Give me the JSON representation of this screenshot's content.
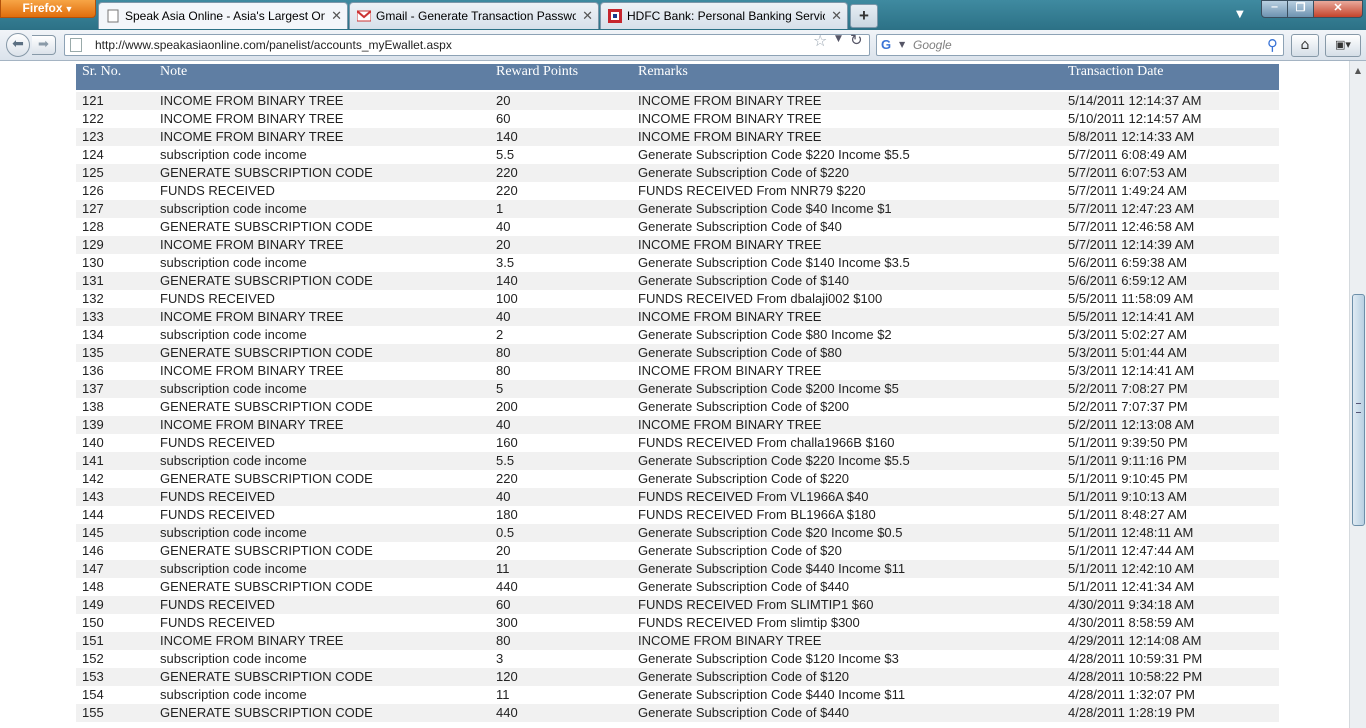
{
  "browser": {
    "menu_button": "Firefox",
    "tabs": [
      {
        "title": "Speak Asia Online - Asia's Largest Onl...",
        "active": true
      },
      {
        "title": "Gmail - Generate Transaction Passwo...",
        "active": false
      },
      {
        "title": "HDFC Bank: Personal Banking Services",
        "active": false
      }
    ],
    "new_tab": "+",
    "url": "http://www.speakasiaonline.com/panelist/accounts_myEwallet.aspx",
    "search_placeholder": "Google"
  },
  "table": {
    "headers": [
      "Sr. No.",
      "Note",
      "Reward Points",
      "Remarks",
      "Transaction Date"
    ],
    "rows": [
      [
        "121",
        "INCOME FROM BINARY TREE",
        "20",
        "INCOME FROM BINARY TREE",
        "5/14/2011 12:14:37 AM"
      ],
      [
        "122",
        "INCOME FROM BINARY TREE",
        "60",
        "INCOME FROM BINARY TREE",
        "5/10/2011 12:14:57 AM"
      ],
      [
        "123",
        "INCOME FROM BINARY TREE",
        "140",
        "INCOME FROM BINARY TREE",
        "5/8/2011 12:14:33 AM"
      ],
      [
        "124",
        "subscription code income",
        "5.5",
        "Generate Subscription Code $220 Income $5.5",
        "5/7/2011 6:08:49 AM"
      ],
      [
        "125",
        "GENERATE SUBSCRIPTION CODE",
        "220",
        "Generate Subscription Code of $220",
        "5/7/2011 6:07:53 AM"
      ],
      [
        "126",
        "FUNDS RECEIVED",
        "220",
        "FUNDS RECEIVED From NNR79 $220",
        "5/7/2011 1:49:24 AM"
      ],
      [
        "127",
        "subscription code income",
        "1",
        "Generate Subscription Code $40 Income $1",
        "5/7/2011 12:47:23 AM"
      ],
      [
        "128",
        "GENERATE SUBSCRIPTION CODE",
        "40",
        "Generate Subscription Code of $40",
        "5/7/2011 12:46:58 AM"
      ],
      [
        "129",
        "INCOME FROM BINARY TREE",
        "20",
        "INCOME FROM BINARY TREE",
        "5/7/2011 12:14:39 AM"
      ],
      [
        "130",
        "subscription code income",
        "3.5",
        "Generate Subscription Code $140 Income $3.5",
        "5/6/2011 6:59:38 AM"
      ],
      [
        "131",
        "GENERATE SUBSCRIPTION CODE",
        "140",
        "Generate Subscription Code of $140",
        "5/6/2011 6:59:12 AM"
      ],
      [
        "132",
        "FUNDS RECEIVED",
        "100",
        "FUNDS RECEIVED From dbalaji002 $100",
        "5/5/2011 11:58:09 AM"
      ],
      [
        "133",
        "INCOME FROM BINARY TREE",
        "40",
        "INCOME FROM BINARY TREE",
        "5/5/2011 12:14:41 AM"
      ],
      [
        "134",
        "subscription code income",
        "2",
        "Generate Subscription Code $80 Income $2",
        "5/3/2011 5:02:27 AM"
      ],
      [
        "135",
        "GENERATE SUBSCRIPTION CODE",
        "80",
        "Generate Subscription Code of $80",
        "5/3/2011 5:01:44 AM"
      ],
      [
        "136",
        "INCOME FROM BINARY TREE",
        "80",
        "INCOME FROM BINARY TREE",
        "5/3/2011 12:14:41 AM"
      ],
      [
        "137",
        "subscription code income",
        "5",
        "Generate Subscription Code $200 Income $5",
        "5/2/2011 7:08:27 PM"
      ],
      [
        "138",
        "GENERATE SUBSCRIPTION CODE",
        "200",
        "Generate Subscription Code of $200",
        "5/2/2011 7:07:37 PM"
      ],
      [
        "139",
        "INCOME FROM BINARY TREE",
        "40",
        "INCOME FROM BINARY TREE",
        "5/2/2011 12:13:08 AM"
      ],
      [
        "140",
        "FUNDS RECEIVED",
        "160",
        "FUNDS RECEIVED From challa1966B $160",
        "5/1/2011 9:39:50 PM"
      ],
      [
        "141",
        "subscription code income",
        "5.5",
        "Generate Subscription Code $220 Income $5.5",
        "5/1/2011 9:11:16 PM"
      ],
      [
        "142",
        "GENERATE SUBSCRIPTION CODE",
        "220",
        "Generate Subscription Code of $220",
        "5/1/2011 9:10:45 PM"
      ],
      [
        "143",
        "FUNDS RECEIVED",
        "40",
        "FUNDS RECEIVED From VL1966A $40",
        "5/1/2011 9:10:13 AM"
      ],
      [
        "144",
        "FUNDS RECEIVED",
        "180",
        "FUNDS RECEIVED From BL1966A $180",
        "5/1/2011 8:48:27 AM"
      ],
      [
        "145",
        "subscription code income",
        "0.5",
        "Generate Subscription Code $20 Income $0.5",
        "5/1/2011 12:48:11 AM"
      ],
      [
        "146",
        "GENERATE SUBSCRIPTION CODE",
        "20",
        "Generate Subscription Code of $20",
        "5/1/2011 12:47:44 AM"
      ],
      [
        "147",
        "subscription code income",
        "11",
        "Generate Subscription Code $440 Income $11",
        "5/1/2011 12:42:10 AM"
      ],
      [
        "148",
        "GENERATE SUBSCRIPTION CODE",
        "440",
        "Generate Subscription Code of $440",
        "5/1/2011 12:41:34 AM"
      ],
      [
        "149",
        "FUNDS RECEIVED",
        "60",
        "FUNDS RECEIVED From SLIMTIP1 $60",
        "4/30/2011 9:34:18 AM"
      ],
      [
        "150",
        "FUNDS RECEIVED",
        "300",
        "FUNDS RECEIVED From slimtip $300",
        "4/30/2011 8:58:59 AM"
      ],
      [
        "151",
        "INCOME FROM BINARY TREE",
        "80",
        "INCOME FROM BINARY TREE",
        "4/29/2011 12:14:08 AM"
      ],
      [
        "152",
        "subscription code income",
        "3",
        "Generate Subscription Code $120 Income $3",
        "4/28/2011 10:59:31 PM"
      ],
      [
        "153",
        "GENERATE SUBSCRIPTION CODE",
        "120",
        "Generate Subscription Code of $120",
        "4/28/2011 10:58:22 PM"
      ],
      [
        "154",
        "subscription code income",
        "11",
        "Generate Subscription Code $440 Income $11",
        "4/28/2011 1:32:07 PM"
      ],
      [
        "155",
        "GENERATE SUBSCRIPTION CODE",
        "440",
        "Generate Subscription Code of $440",
        "4/28/2011 1:28:19 PM"
      ]
    ]
  },
  "colors": {
    "header_bg": "#5f7ea3",
    "row_alt_bg": "#f1f1f1",
    "firefox_orange": "#e8811f"
  }
}
